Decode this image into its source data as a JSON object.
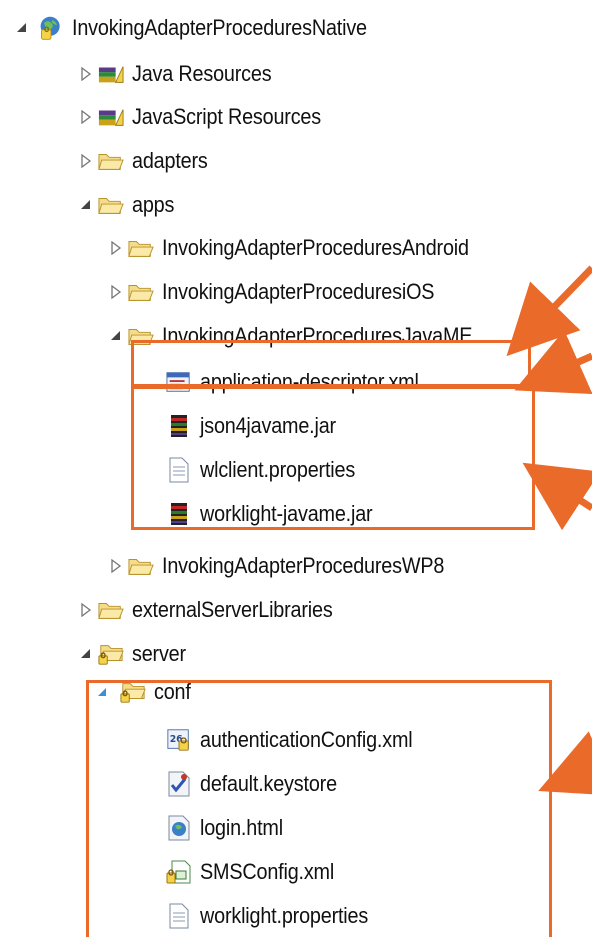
{
  "tree": {
    "items": [
      {
        "label": "InvokingAdapterProceduresNative",
        "icon": "project-icon",
        "toggle": "expanded"
      },
      {
        "label": "Java Resources",
        "icon": "library-icon",
        "toggle": "collapsed"
      },
      {
        "label": "JavaScript Resources",
        "icon": "library-icon",
        "toggle": "collapsed"
      },
      {
        "label": "adapters",
        "icon": "folder-icon",
        "toggle": "collapsed"
      },
      {
        "label": "apps",
        "icon": "folder-icon",
        "toggle": "expanded"
      },
      {
        "label": "InvokingAdapterProceduresAndroid",
        "icon": "folder-icon",
        "toggle": "collapsed"
      },
      {
        "label": "InvokingAdapterProceduresiOS",
        "icon": "folder-icon",
        "toggle": "collapsed"
      },
      {
        "label": "InvokingAdapterProceduresJavaME",
        "icon": "folder-icon",
        "toggle": "expanded"
      },
      {
        "label": "application-descriptor.xml",
        "icon": "xml-descriptor-icon",
        "toggle": "none"
      },
      {
        "label": "json4javame.jar",
        "icon": "jar-icon",
        "toggle": "none"
      },
      {
        "label": "wlclient.properties",
        "icon": "text-file-icon",
        "toggle": "none"
      },
      {
        "label": "worklight-javame.jar",
        "icon": "jar-icon",
        "toggle": "none"
      },
      {
        "label": "InvokingAdapterProceduresWP8",
        "icon": "folder-icon",
        "toggle": "collapsed"
      },
      {
        "label": "externalServerLibraries",
        "icon": "folder-icon",
        "toggle": "collapsed"
      },
      {
        "label": "server",
        "icon": "locked-folder-icon",
        "toggle": "expanded"
      },
      {
        "label": "conf",
        "icon": "locked-folder-icon",
        "toggle": "expanded"
      },
      {
        "label": "authenticationConfig.xml",
        "icon": "locked-xml-icon",
        "toggle": "none"
      },
      {
        "label": "default.keystore",
        "icon": "keystore-icon",
        "toggle": "none"
      },
      {
        "label": "login.html",
        "icon": "html-globe-icon",
        "toggle": "none"
      },
      {
        "label": "SMSConfig.xml",
        "icon": "sms-config-icon",
        "toggle": "none"
      },
      {
        "label": "worklight.properties",
        "icon": "text-file-icon",
        "toggle": "none"
      }
    ]
  },
  "colors": {
    "highlight": "#ea6a2a",
    "folder": "#e8c65a",
    "selection-arrow": "#3b8fd6"
  }
}
